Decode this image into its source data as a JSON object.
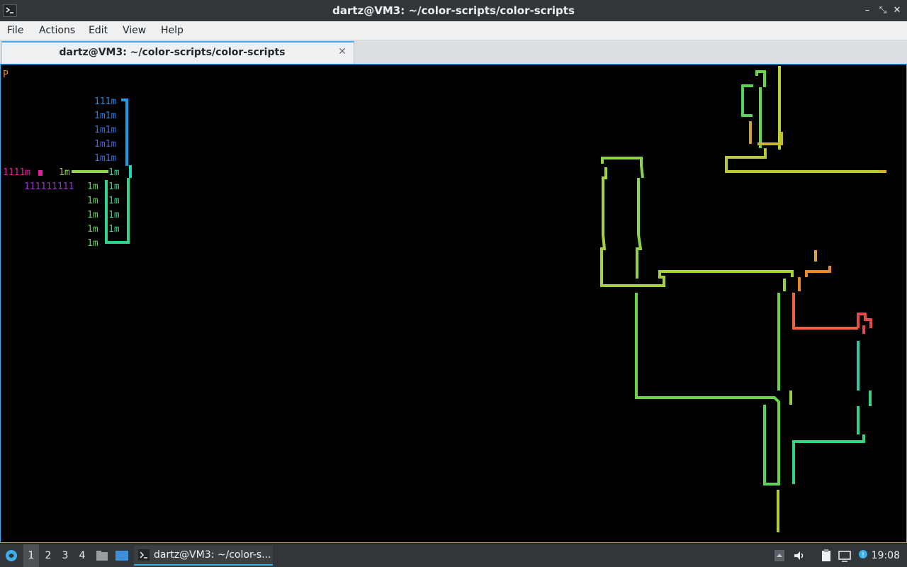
{
  "window": {
    "title": "dartz@VM3: ~/color-scripts/color-scripts",
    "buttons": {
      "minimize": "–",
      "maximize": "⤡",
      "close": "✕"
    }
  },
  "menubar": {
    "items": [
      "File",
      "Actions",
      "Edit",
      "View",
      "Help"
    ]
  },
  "tabs": [
    {
      "label": "dartz@VM3: ~/color-scripts/color-scripts",
      "close": "✕"
    }
  ],
  "terminal": {
    "prompt_char": "P",
    "glyph_rows": [
      {
        "text": "111m",
        "color": "#1e88e5"
      },
      {
        "text": "1m1m",
        "color": "#2a7be4"
      },
      {
        "text": "1m1m",
        "color": "#3b6fe0"
      },
      {
        "text": "1m1m",
        "color": "#4f63d8"
      },
      {
        "text": "1m1m",
        "color": "#3b6fe0"
      },
      {
        "text": "1111m",
        "color": "#e0209a"
      },
      {
        "text": "1m",
        "color": "#8ed34a"
      },
      {
        "text": "1m",
        "color": "#2bd39a"
      },
      {
        "text": "111111111",
        "color": "#9b2fd0"
      },
      {
        "text": "1m",
        "color": "#5bd35b"
      },
      {
        "text": "1m",
        "color": "#2fd38a"
      },
      {
        "text": "1m",
        "color": "#5bd35b"
      },
      {
        "text": "1m",
        "color": "#2fd38a"
      },
      {
        "text": "1m",
        "color": "#5bd35b"
      },
      {
        "text": "1m",
        "color": "#2fd38a"
      },
      {
        "text": "1m",
        "color": "#5bd35b"
      },
      {
        "text": "1m",
        "color": "#2fd38a"
      },
      {
        "text": "1m",
        "color": "#5bd35b"
      }
    ]
  },
  "taskbar": {
    "workspaces": [
      "1",
      "2",
      "3",
      "4"
    ],
    "active_workspace": "1",
    "task_label": "dartz@VM3: ~/color-s...",
    "clock": "19:08",
    "tray_icons": [
      "tray-up-arrow-icon",
      "volume-icon",
      "clipboard-icon",
      "network-icon",
      "notification-icon"
    ]
  },
  "colors": {
    "accent": "#3daee9",
    "panel": "#31363b",
    "terminal_bg": "#000000"
  }
}
